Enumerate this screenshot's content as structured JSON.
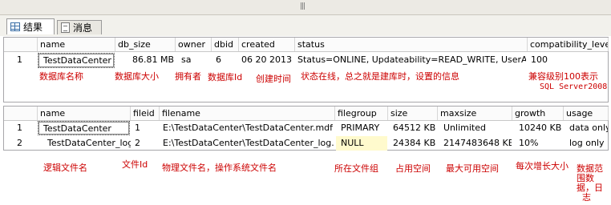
{
  "tabs": [
    {
      "label": "结果",
      "icon": "grid-icon"
    },
    {
      "label": "消息",
      "icon": "document-icon"
    }
  ],
  "grid1": {
    "columns": [
      "name",
      "db_size",
      "owner",
      "dbid",
      "created",
      "status",
      "compatibility_level"
    ],
    "row": {
      "num": "1",
      "name": "TestDataCenter",
      "db_size": "86.81 MB",
      "owner": "sa",
      "dbid": "6",
      "created": "06 20 2013",
      "status": "Status=ONLINE, Updateability=READ_WRITE, UserAc...",
      "compatibility_level": "100"
    },
    "annotations": {
      "name": "数据库名称",
      "db_size": "数据库大小",
      "owner": "拥有者",
      "dbid": "数据库Id",
      "created": "创建时间",
      "status": "状态在线，总之就是建库时，设置的信息",
      "compat_line1": "兼容级别100表示",
      "compat_line2": "SQL Server2008"
    }
  },
  "grid2": {
    "columns": [
      "name",
      "fileid",
      "filename",
      "filegroup",
      "size",
      "maxsize",
      "growth",
      "usage"
    ],
    "rows": [
      {
        "num": "1",
        "name": "TestDataCenter",
        "fileid": "1",
        "filename": "E:\\TestDataCenter\\TestDataCenter.mdf",
        "filegroup": "PRIMARY",
        "size": "64512 KB",
        "maxsize": "Unlimited",
        "growth": "10240 KB",
        "usage": "data only"
      },
      {
        "num": "2",
        "name": "TestDataCenter_log",
        "fileid": "2",
        "filename": "E:\\TestDataCenter\\TestDataCenter_log.ldf",
        "filegroup": "NULL",
        "size": "24384 KB",
        "maxsize": "2147483648 KB",
        "growth": "10%",
        "usage": "log only"
      }
    ],
    "annotations": {
      "name": "逻辑文件名",
      "fileid": "文件Id",
      "filename": "物理文件名，操作系统文件名",
      "filegroup": "所在文件组",
      "size": "占用空间",
      "maxsize": "最大可用空间",
      "growth": "每次增长大小",
      "usage_1": "数据范",
      "usage_2": "围数",
      "usage_3": "据，日",
      "usage_4": "志"
    }
  }
}
